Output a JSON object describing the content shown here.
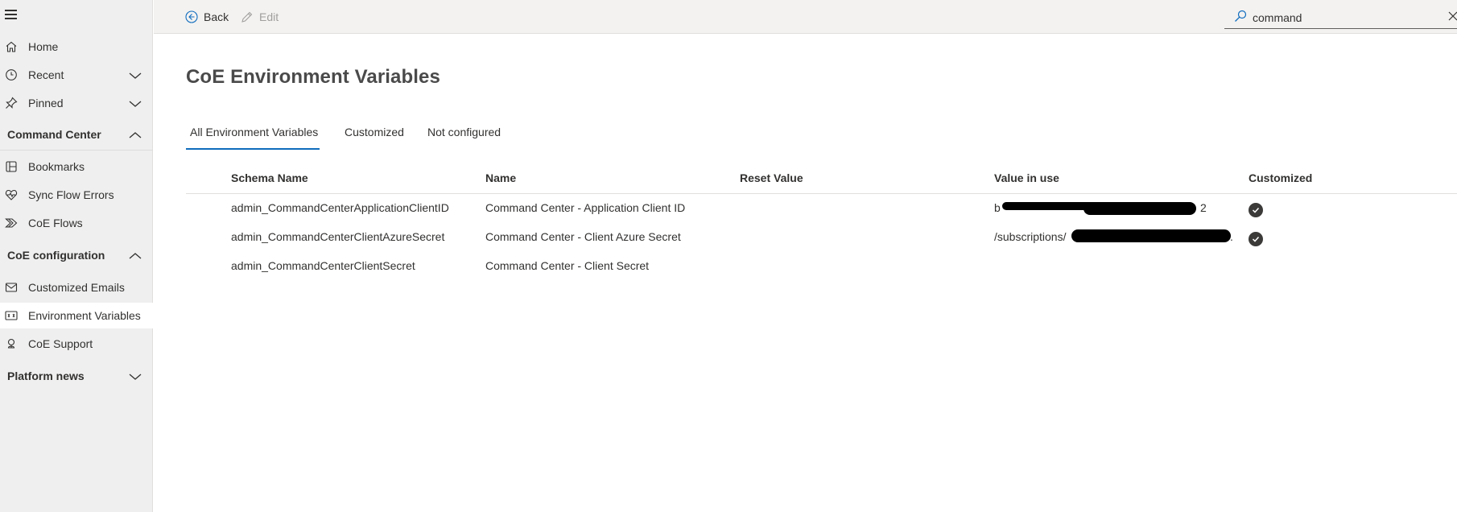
{
  "sidebar": {
    "items": [
      {
        "label": "Home",
        "icon": "home-icon"
      },
      {
        "label": "Recent",
        "icon": "clock-icon"
      },
      {
        "label": "Pinned",
        "icon": "pin-icon"
      }
    ],
    "groups": [
      {
        "label": "Command Center",
        "expanded": true,
        "items": [
          {
            "label": "Bookmarks",
            "icon": "bookmarks-icon"
          },
          {
            "label": "Sync Flow Errors",
            "icon": "heart-pulse-icon"
          },
          {
            "label": "CoE Flows",
            "icon": "flow-icon"
          }
        ]
      },
      {
        "label": "CoE configuration",
        "expanded": true,
        "items": [
          {
            "label": "Customized Emails",
            "icon": "mail-icon"
          },
          {
            "label": "Environment Variables",
            "icon": "variables-icon",
            "active": true
          },
          {
            "label": "CoE Support",
            "icon": "support-icon"
          }
        ]
      },
      {
        "label": "Platform news",
        "expanded": false
      }
    ]
  },
  "toolbar": {
    "back_label": "Back",
    "edit_label": "Edit",
    "search_value": "command"
  },
  "page": {
    "title": "CoE Environment Variables",
    "tabs": [
      "All Environment Variables",
      "Customized",
      "Not configured"
    ],
    "active_tab": "All Environment Variables"
  },
  "grid": {
    "columns": [
      "Schema Name",
      "Name",
      "Reset Value",
      "Value in use",
      "Customized"
    ],
    "rows": [
      {
        "schema": "admin_CommandCenterApplicationClientID",
        "name": "Command Center - Application Client ID",
        "reset": "",
        "value_prefix": "b",
        "value_suffix": "2",
        "customized": true
      },
      {
        "schema": "admin_CommandCenterClientAzureSecret",
        "name": "Command Center - Client Azure Secret",
        "reset": "",
        "value_prefix": "/subscriptions/",
        "value_suffix": ".",
        "customized": true
      },
      {
        "schema": "admin_CommandCenterClientSecret",
        "name": "Command Center - Client Secret",
        "reset": "",
        "value_prefix": "",
        "value_suffix": "",
        "customized": false
      }
    ]
  },
  "colors": {
    "accent": "#0f6cbd",
    "sidebar_bg": "#efefef",
    "topbar_bg": "#f3f2f1"
  }
}
